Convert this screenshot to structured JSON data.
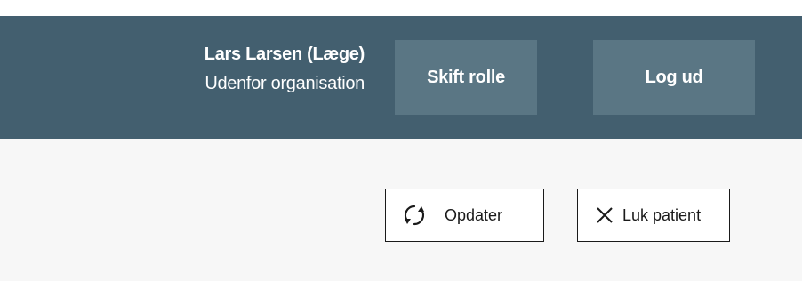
{
  "header": {
    "user_name": "Lars Larsen (Læge)",
    "organization": "Udenfor organisation",
    "switch_role_label": "Skift rolle",
    "logout_label": "Log ud"
  },
  "toolbar": {
    "refresh_label": "Opdater",
    "refresh_icon": "refresh-icon",
    "close_patient_label": "Luk patient",
    "close_icon": "close-icon"
  },
  "colors": {
    "header_bg": "#435f6f",
    "header_button_bg": "#5a7684",
    "content_bg": "#f7f7f7",
    "button_border": "#1a1a1a"
  }
}
